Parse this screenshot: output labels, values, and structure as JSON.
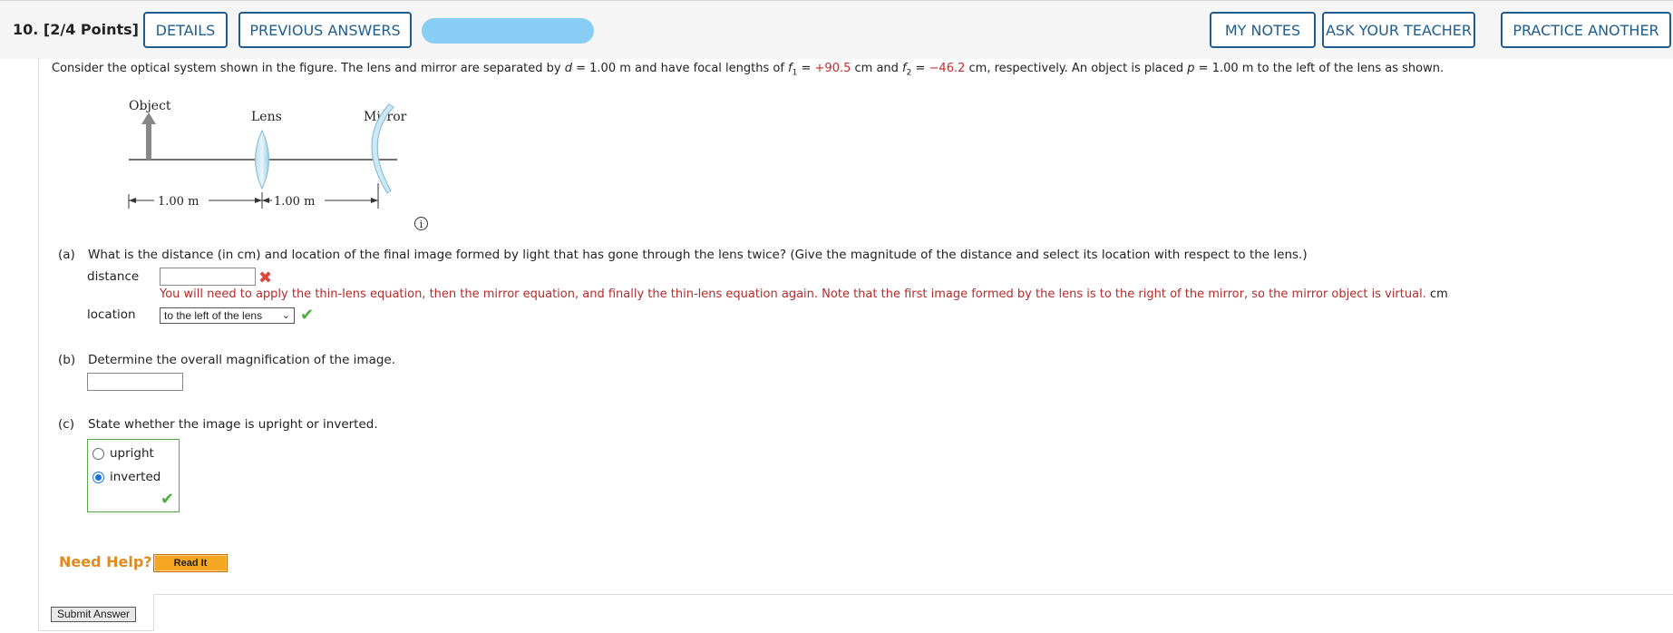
{
  "header": {
    "question_number": "10.",
    "points": "[2/4 Points]",
    "details_label": "DETAILS",
    "previous_answers_label": "PREVIOUS ANSWERS",
    "my_notes_label": "MY NOTES",
    "ask_teacher_label": "ASK YOUR TEACHER",
    "practice_another_label": "PRACTICE ANOTHER"
  },
  "prompt": {
    "t1": "Consider the optical system shown in the figure. The lens and mirror are separated by ",
    "d_var": "d",
    "t2": " = 1.00 m and have focal lengths of ",
    "f_var": "f",
    "f1_sub": "1",
    "t3": " = ",
    "f1_val": "+90.5",
    "t4": " cm and ",
    "f2_sub": "2",
    "t5": " = ",
    "f2_val": "−46.2",
    "t6": " cm, respectively. An object is placed ",
    "p_var": "p",
    "t7": " = 1.00 m to the left of the lens as shown."
  },
  "figure": {
    "object_label": "Object",
    "lens_label": "Lens",
    "mirror_label": "Mirror",
    "dist1": "1.00 m",
    "dist2": "1.00 m"
  },
  "part_a": {
    "label": "(a)",
    "question": "What is the distance (in cm) and location of the final image formed by light that has gone through the lens twice? (Give the magnitude of the distance and select its location with respect to the lens.)",
    "distance_label": "distance",
    "distance_value": "",
    "hint": "You will need to apply the thin-lens equation, then the mirror equation, and finally the thin-lens equation again. Note that the first image formed by the lens is to the right of the mirror, so the mirror object is virtual.",
    "unit": "cm",
    "location_label": "location",
    "location_selected": "to the left of the lens"
  },
  "part_b": {
    "label": "(b)",
    "question": "Determine the overall magnification of the image.",
    "value": ""
  },
  "part_c": {
    "label": "(c)",
    "question": "State whether the image is upright or inverted.",
    "options": [
      "upright",
      "inverted"
    ],
    "selected": "inverted"
  },
  "help": {
    "need_help": "Need Help?",
    "read_it": "Read It"
  },
  "submit_label": "Submit Answer",
  "colors": {
    "accent": "#1f5d8c",
    "error": "#cc2a2a",
    "correct": "#4caf3c",
    "help": "#e08a1f"
  }
}
